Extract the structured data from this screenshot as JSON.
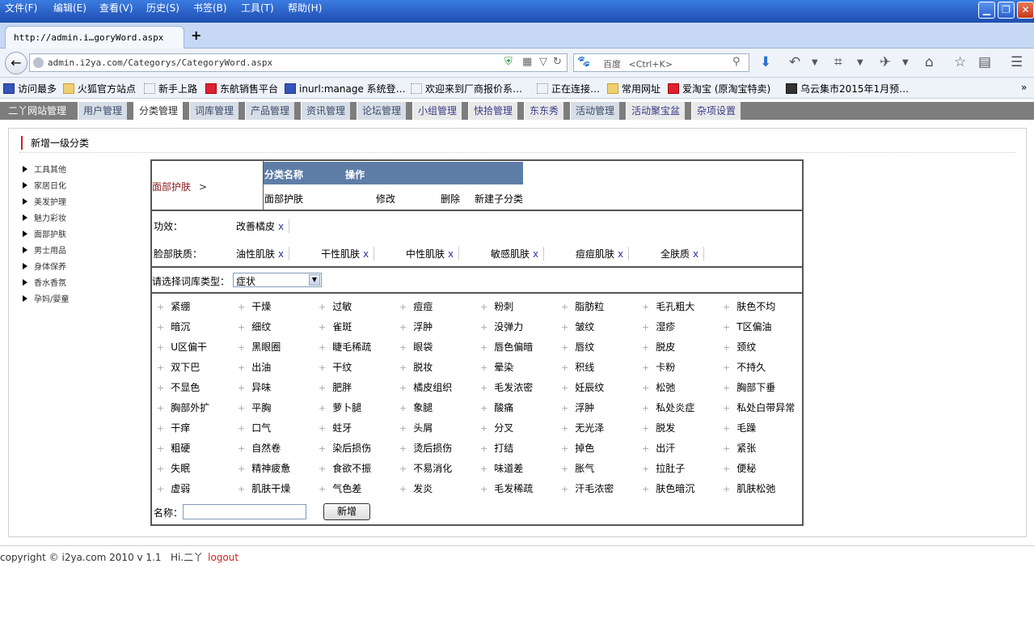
{
  "browser": {
    "menu": [
      "文件(F)",
      "编辑(E)",
      "查看(V)",
      "历史(S)",
      "书签(B)",
      "工具(T)",
      "帮助(H)"
    ],
    "tab_title": "http://admin.i…goryWord.aspx",
    "new_tab": "+",
    "url": "admin.i2ya.com/Categorys/CategoryWord.aspx",
    "search_engine": "百度",
    "search_placeholder": "<Ctrl+K>",
    "bookmarks": [
      "访问最多",
      "火狐官方站点",
      "新手上路",
      "东航销售平台",
      "inurl:manage 系统登…",
      "欢迎来到厂商报价系…",
      "正在连接…",
      "常用网址",
      "爱淘宝 (原淘宝特卖)",
      "乌云集市2015年1月预…"
    ]
  },
  "adminnav": {
    "brand": "二丫网站管理",
    "tabs": [
      "用户管理",
      "分类管理",
      "词库管理",
      "产品管理",
      "资讯管理",
      "论坛管理",
      "小组管理",
      "快拾管理",
      "东东秀",
      "活动管理",
      "活动聚宝盆",
      "杂项设置"
    ],
    "active": "分类管理"
  },
  "section_title": "新增一级分类",
  "tree": [
    "工具其他",
    "家居日化",
    "美发护理",
    "魅力彩妆",
    "面部护肤",
    "男士用品",
    "身体保养",
    "香水香氛",
    "孕妈/婴童"
  ],
  "crumb": {
    "label": "面部护肤",
    "sep": ">"
  },
  "category_table": {
    "headers": [
      "分类名称",
      "操作"
    ],
    "row": {
      "name": "面部护肤",
      "edit": "修改",
      "delete": "删除",
      "new_child": "新建子分类"
    }
  },
  "effect": {
    "label": "功效：",
    "tags": [
      "改善橘皮"
    ]
  },
  "skin": {
    "label": "脸部肤质：",
    "tags": [
      "油性肌肤",
      "干性肌肤",
      "中性肌肤",
      "敏感肌肤",
      "痘痘肌肤",
      "全肤质"
    ]
  },
  "remove_glyph": "x",
  "vocab": {
    "label": "请选择词库类型：",
    "selected": "症状"
  },
  "terms": [
    "紧绷",
    "干燥",
    "过敏",
    "痘痘",
    "粉刺",
    "脂肪粒",
    "毛孔粗大",
    "肤色不均",
    "暗沉",
    "细纹",
    "雀斑",
    "浮肿",
    "没弹力",
    "皱纹",
    "湿疹",
    "T区偏油",
    "U区偏干",
    "黑眼圈",
    "睫毛稀疏",
    "眼袋",
    "唇色偏暗",
    "唇纹",
    "脱皮",
    "颈纹",
    "双下巴",
    "出油",
    "干纹",
    "脱妆",
    "晕染",
    "积线",
    "卡粉",
    "不持久",
    "不显色",
    "异味",
    "肥胖",
    "橘皮组织",
    "毛发浓密",
    "妊辰纹",
    "松弛",
    "胸部下垂",
    "胸部外扩",
    "平胸",
    "萝卜腿",
    "象腿",
    "酸痛",
    "浮肿",
    "私处炎症",
    "私处白带异常",
    "干痒",
    "口气",
    "蛀牙",
    "头屑",
    "分叉",
    "无光泽",
    "脱发",
    "毛躁",
    "粗硬",
    "自然卷",
    "染后损伤",
    "烫后损伤",
    "打结",
    "掉色",
    "出汗",
    "紧张",
    "失眠",
    "精神疲惫",
    "食欲不振",
    "不易消化",
    "味道差",
    "胀气",
    "拉肚子",
    "便秘",
    "虚弱",
    "肌肤干燥",
    "气色差",
    "发炎",
    "毛发稀疏",
    "汗毛浓密",
    "肤色暗沉",
    "肌肤松弛"
  ],
  "plus_glyph": "+",
  "form": {
    "name_label": "名称：",
    "name_value": "",
    "add_button": "新增"
  },
  "footer": {
    "text": "copyright © i2ya.com 2010 v 1.1   Hi.二丫",
    "logout": "logout"
  }
}
